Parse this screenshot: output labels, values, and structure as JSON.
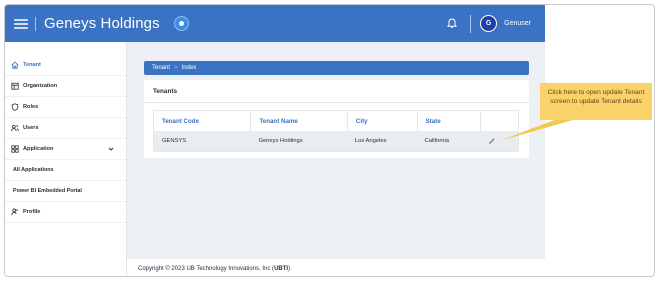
{
  "header": {
    "app_title": "Geneys Holdings",
    "avatar_initial": "G",
    "username": "Genuser"
  },
  "sidebar": {
    "items": [
      {
        "label": "Tenant",
        "icon": "home-icon",
        "active": true
      },
      {
        "label": "Organization",
        "icon": "building-icon"
      },
      {
        "label": "Roles",
        "icon": "shield-icon"
      },
      {
        "label": "Users",
        "icon": "users-icon"
      },
      {
        "label": "Application",
        "icon": "apps-grid-icon",
        "expanded": true
      },
      {
        "label": "All Applications"
      },
      {
        "label": "Power BI Embedded Portal"
      },
      {
        "label": "Profile",
        "icon": "profile-icon"
      }
    ]
  },
  "breadcrumb": {
    "items": [
      "Tenant",
      "Index"
    ],
    "separator": ">"
  },
  "card": {
    "title": "Tenants"
  },
  "table": {
    "columns": [
      "Tenant Code",
      "Tenant Name",
      "City",
      "State"
    ],
    "rows": [
      {
        "code": "GENSYS",
        "name": "Geneys Holdings",
        "city": "Los Angeles",
        "state": "California"
      }
    ]
  },
  "footer": {
    "text": "Copyright © 2023 UB Technology Innovations, Inc (",
    "bold": "UBTI",
    "close": ")"
  },
  "callout": {
    "text": "Click here to open update Tenant screen to update Tenant details"
  },
  "colors": {
    "primary": "#3a72c4",
    "callout": "#fbd26a"
  }
}
